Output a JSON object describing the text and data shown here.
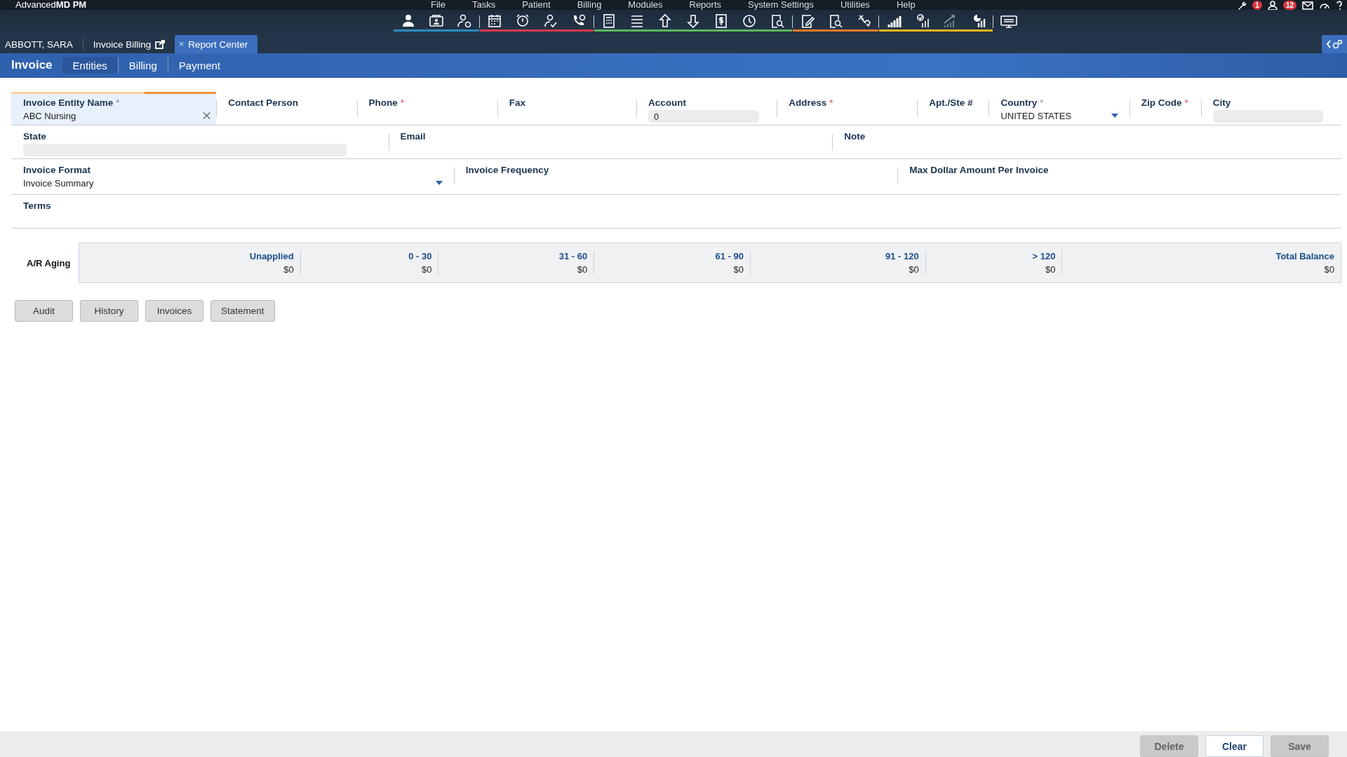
{
  "app": {
    "logo": "Advanced**MD PM**",
    "menu": [
      "File",
      "Tasks",
      "Patient",
      "Billing",
      "Modules",
      "Reports",
      "System Settings",
      "Utilities",
      "Help"
    ],
    "notifications": {
      "tasks": "1",
      "messages": "12"
    }
  },
  "patient_tabs": [
    {
      "label": "ABBOTT, SARA",
      "kind": "plain",
      "selected": false
    },
    {
      "label": "Invoice Billing",
      "kind": "external",
      "selected": false
    },
    {
      "label": "Report Center",
      "kind": "closable",
      "close": "×",
      "selected": true
    }
  ],
  "subnav": {
    "title": "Invoice",
    "tabs": [
      {
        "label": "Entities",
        "selected": true
      },
      {
        "label": "Billing",
        "selected": false
      },
      {
        "label": "Payment",
        "selected": false
      }
    ]
  },
  "form": {
    "rows": [
      {
        "fields": [
          {
            "label": "Invoice Entity Name",
            "asterisk": "*",
            "invalid": false,
            "kind": "text",
            "value": "ABC Nursing",
            "focused": true
          },
          {
            "label": "Contact Person",
            "kind": "text",
            "focused": false
          },
          {
            "label": "Phone",
            "asterisk": "*",
            "invalid": true,
            "kind": "text",
            "focused": false
          },
          {
            "label": "Fax",
            "kind": "text",
            "focused": false
          },
          {
            "label": "Account",
            "kind": "readonly",
            "value": "0",
            "focused": false
          },
          {
            "label": "Address",
            "asterisk": "*",
            "invalid": true,
            "kind": "text",
            "focused": false
          },
          {
            "label": "Apt./Ste #",
            "kind": "text",
            "focused": false
          },
          {
            "label": "Country",
            "asterisk": "*",
            "invalid": false,
            "kind": "dropdown",
            "value": "UNITED STATES",
            "focused": false
          },
          {
            "label": "Zip Code",
            "asterisk": "*",
            "invalid": true,
            "kind": "text",
            "focused": false
          },
          {
            "label": "City",
            "kind": "readonly",
            "focused": false
          }
        ]
      },
      {
        "fields": [
          {
            "label": "State",
            "kind": "readonly",
            "focused": false
          },
          {
            "label": "Email",
            "kind": "text",
            "focused": false
          },
          {
            "label": "Note",
            "kind": "text",
            "focused": false
          }
        ]
      },
      {
        "fields": [
          {
            "label": "Invoice Format",
            "kind": "dropdown",
            "value": "Invoice Summary",
            "focused": false
          },
          {
            "label": "Invoice Frequency",
            "kind": "text",
            "focused": false
          },
          {
            "label": "Max Dollar Amount Per Invoice",
            "kind": "text",
            "focused": false
          }
        ]
      },
      {
        "fields": [
          {
            "label": "Terms",
            "kind": "text",
            "focused": false
          }
        ]
      }
    ]
  },
  "aging": {
    "label": "A/R Aging",
    "columns": [
      {
        "label": "Unapplied",
        "value": "$0"
      },
      {
        "label": "0 - 30",
        "value": "$0"
      },
      {
        "label": "31 - 60",
        "value": "$0"
      },
      {
        "label": "61 - 90",
        "value": "$0"
      },
      {
        "label": "91 - 120",
        "value": "$0"
      },
      {
        "label": "> 120",
        "value": "$0"
      },
      {
        "label": "Total Balance",
        "value": "$0"
      }
    ]
  },
  "actions": [
    "Audit",
    "History",
    "Invoices",
    "Statement"
  ],
  "footer": [
    {
      "label": "Delete",
      "disabled": true
    },
    {
      "label": "Clear",
      "disabled": false
    },
    {
      "label": "Save",
      "disabled": true
    }
  ]
}
